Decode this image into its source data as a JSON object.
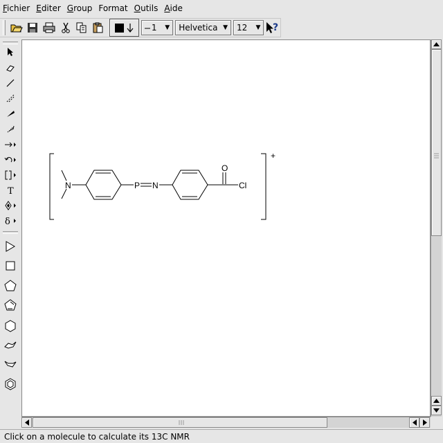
{
  "menu": {
    "items": [
      {
        "underline": "F",
        "rest": "ichier"
      },
      {
        "underline": "E",
        "rest": "diter"
      },
      {
        "underline": "G",
        "rest": "roup"
      },
      {
        "underline": "",
        "rest": "Format"
      },
      {
        "underline": "O",
        "rest": "utils"
      },
      {
        "underline": "A",
        "rest": "ide"
      }
    ]
  },
  "toolbar": {
    "line_width": "1",
    "font_family": "Helvetica",
    "font_size": "12",
    "color": "#000000"
  },
  "molecule": {
    "atoms": {
      "n_amine": "N",
      "phosphorus": "P",
      "n_imine": "N",
      "oxygen": "O",
      "chlorine": "Cl"
    },
    "charge": "+"
  },
  "status": {
    "text": "Click on a molecule to calculate its 13C NMR"
  }
}
